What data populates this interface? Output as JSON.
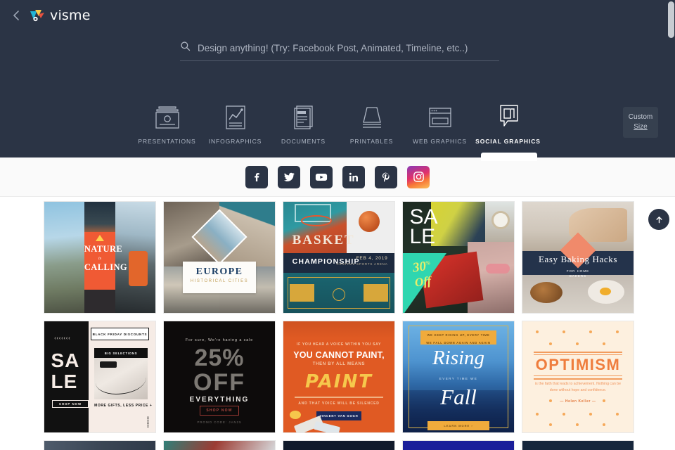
{
  "header": {
    "back_icon": "chevron-left-icon",
    "brand": "visme",
    "logo_icon": "visme-logo-icon"
  },
  "search": {
    "icon": "search-icon",
    "placeholder": "Design anything! (Try: Facebook Post, Animated, Timeline, etc..)",
    "value": ""
  },
  "categories": [
    {
      "label": "PRESENTATIONS",
      "icon": "presentation-icon",
      "active": false
    },
    {
      "label": "INFOGRAPHICS",
      "icon": "infographic-chart-icon",
      "active": false
    },
    {
      "label": "DOCUMENTS",
      "icon": "document-icon",
      "active": false
    },
    {
      "label": "PRINTABLES",
      "icon": "printable-icon",
      "active": false
    },
    {
      "label": "WEB GRAPHICS",
      "icon": "web-graphics-icon",
      "active": false
    },
    {
      "label": "SOCIAL GRAPHICS",
      "icon": "social-graphics-icon",
      "active": true
    }
  ],
  "custom_size": {
    "line1": "Custom",
    "line2": "Size"
  },
  "social_networks": [
    {
      "name": "facebook",
      "glyph": "f"
    },
    {
      "name": "twitter",
      "glyph": "twitter-bird-icon"
    },
    {
      "name": "youtube",
      "glyph": "youtube-play-icon"
    },
    {
      "name": "linkedin",
      "glyph": "in"
    },
    {
      "name": "pinterest",
      "glyph": "P"
    },
    {
      "name": "instagram",
      "glyph": "instagram-camera-icon"
    }
  ],
  "scroll_top": {
    "icon": "arrow-up-icon",
    "label": ""
  },
  "templates": [
    {
      "id": "nature-is-calling",
      "title": "NATURE",
      "script": "is",
      "subtitle": "CALLING"
    },
    {
      "id": "europe-historical-cities",
      "title": "EUROPE",
      "subtitle": "HISTORICAL CITIES"
    },
    {
      "id": "basket-championship",
      "title": "BASKET",
      "subtitle": "CHAMPIONSHIP",
      "date": "FEB 4, 2019",
      "venue": "CENTRAL SPORTS ARENA"
    },
    {
      "id": "sale-30-off",
      "title": "SA",
      "title2": "LE",
      "discount": "30",
      "discount_sup": "%",
      "off": "Off"
    },
    {
      "id": "easy-baking-hacks",
      "title": "Easy Baking Hacks",
      "subtitle_line1": "FOR HOME",
      "subtitle_line2": "BAKERS"
    },
    {
      "id": "black-friday-sale",
      "ribbon": "BLACK FRIDAY DISCOUNTS",
      "photo_bar": "BIG SELECTIONS",
      "title": "SA",
      "title2": "LE",
      "button": "SHOP NOW",
      "footer": "MORE GIFTS, LESS PRICE +",
      "dots": "‹‹‹‹‹‹‹"
    },
    {
      "id": "25-percent-off-everything",
      "kicker": "For sure, We're having a sale",
      "big1": "25%",
      "big2": "OFF",
      "label": "EVERYTHING",
      "button": "SHOP NOW",
      "code": "PROMO CODE: JAN25"
    },
    {
      "id": "van-gogh-paint-quote",
      "line1": "IF YOU HEAR A VOICE WITHIN YOU SAY",
      "line2": "YOU CANNOT PAINT,",
      "line3": "THEN BY ALL MEANS",
      "word": "PAINT",
      "line4": "AND THAT VOICE WILL BE SILENCED",
      "author": "VINCENT VAN GOGH"
    },
    {
      "id": "rising-every-time-we-fall",
      "banner_line1": "WE KEEP RISING UP, EVERY TIME",
      "banner_line2": "WE FALL DOWN AGAIN AND AGAIN",
      "title": "Rising",
      "middle": "EVERY TIME WE",
      "title2": "Fall",
      "footer": "LEARN MORE ›"
    },
    {
      "id": "optimism-quote",
      "title": "OPTIMISM",
      "body": "is the faith that leads to achievement. Nothing can be done without hope and confidence.",
      "author": "— Helen Keller —"
    }
  ],
  "row3_partial": [
    {
      "id": "partial-1"
    },
    {
      "id": "partial-2"
    },
    {
      "id": "partial-3"
    },
    {
      "id": "partial-4"
    },
    {
      "id": "partial-5"
    }
  ],
  "colors": {
    "header_bg": "#2b3445",
    "accent_orange": "#f05a34",
    "active_tab_text": "#ffffff",
    "inactive_tab_text": "#aeb6c4",
    "card_bg": "#ffffff"
  }
}
